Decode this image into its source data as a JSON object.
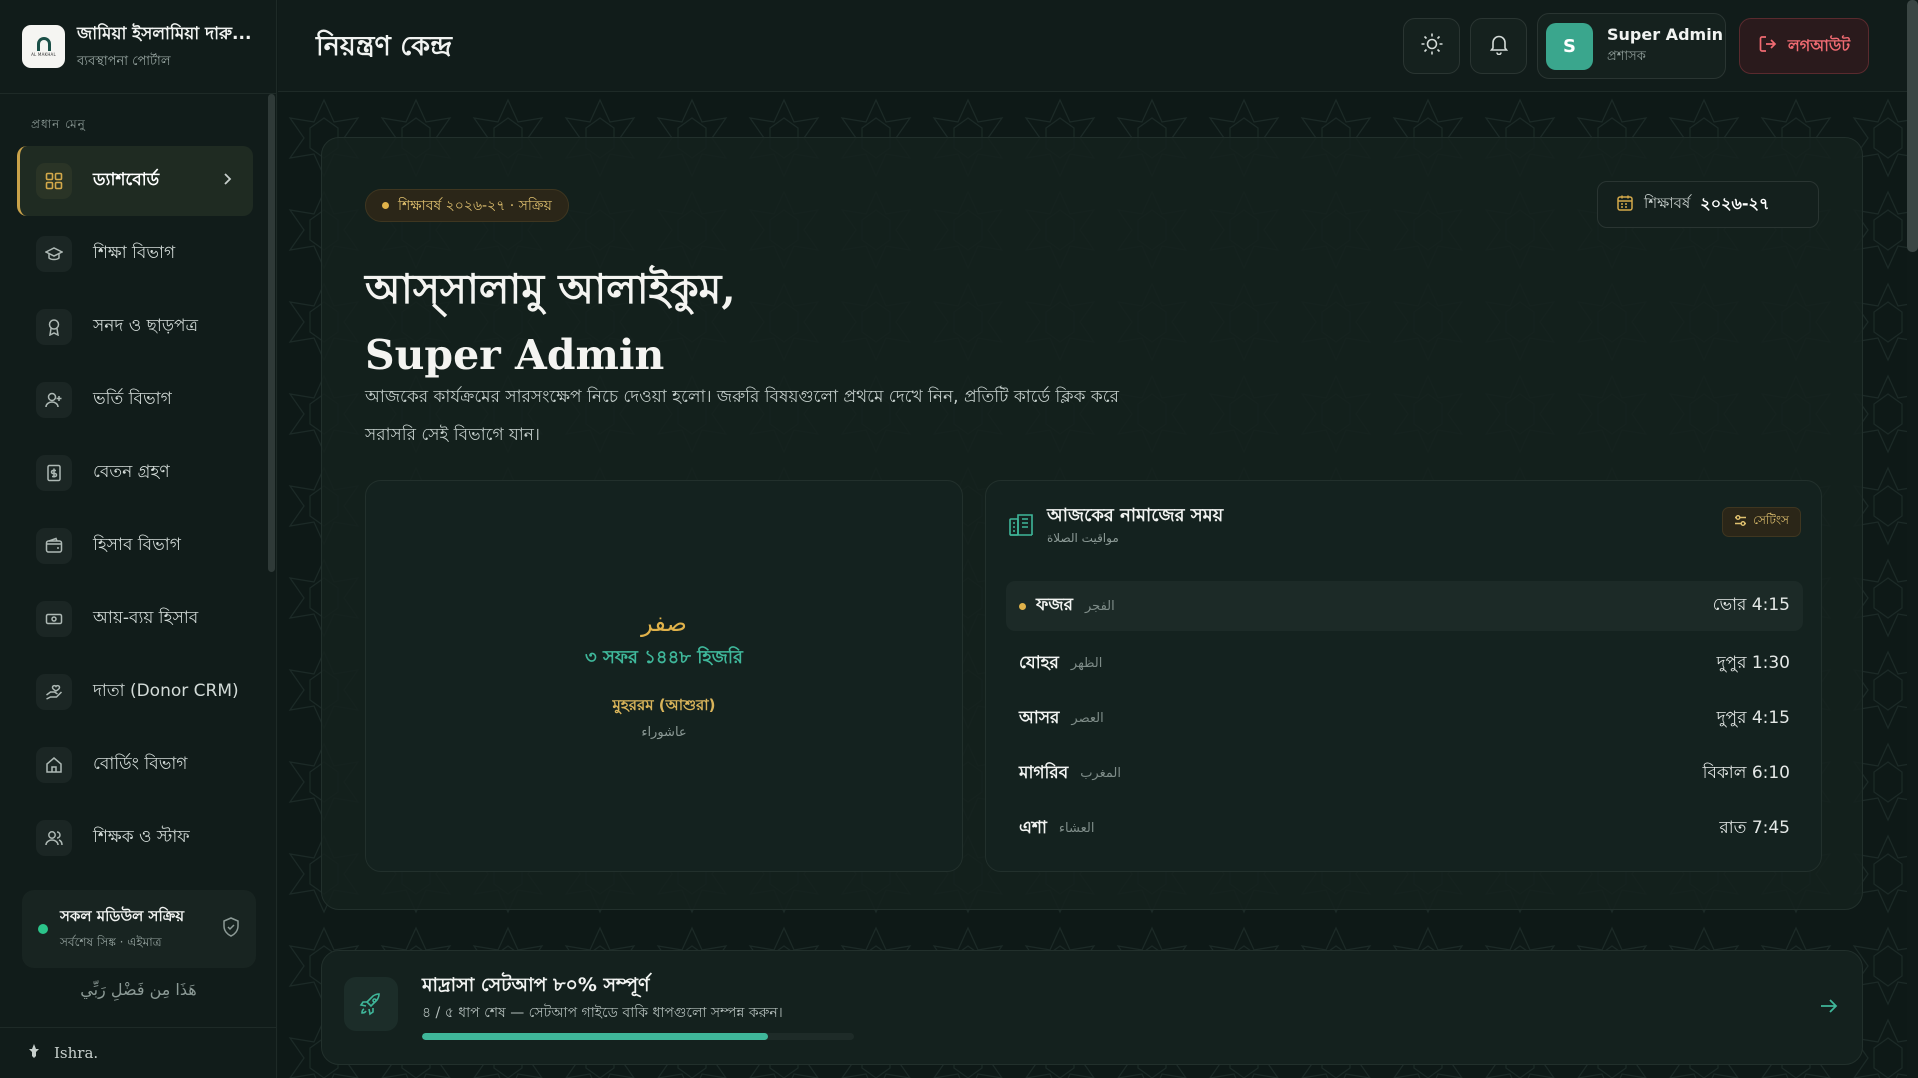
{
  "brand": {
    "title": "জামিয়া ইসলামিয়া দারু...",
    "subtitle": "ব্যবস্থাপনা পোর্টাল",
    "logo_text": "AL MAKHAL"
  },
  "sidebar": {
    "section_label": "প্রধান মেনু",
    "items": [
      {
        "label": "ড্যাশবোর্ড",
        "icon": "grid-icon",
        "active": true
      },
      {
        "label": "শিক্ষা বিভাগ",
        "icon": "graduation-cap-icon"
      },
      {
        "label": "সনদ ও ছাড়পত্র",
        "icon": "award-icon"
      },
      {
        "label": "ভর্তি বিভাগ",
        "icon": "user-plus-icon"
      },
      {
        "label": "বেতন গ্রহণ",
        "icon": "receipt-icon"
      },
      {
        "label": "হিসাব বিভাগ",
        "icon": "wallet-icon"
      },
      {
        "label": "আয়-ব্যয় হিসাব",
        "icon": "cash-icon"
      },
      {
        "label": "দাতা (Donor CRM)",
        "icon": "hand-heart-icon"
      },
      {
        "label": "বোর্ডিং বিভাগ",
        "icon": "home-icon"
      },
      {
        "label": "শিক্ষক ও স্টাফ",
        "icon": "users-icon"
      }
    ],
    "status": {
      "title": "সকল মডিউল সক্রিয়",
      "subtitle": "সর্বশেষ সিঙ্ক · এইমাত্র"
    },
    "arabic_footer": "هَذَا مِن فَضْلِ رَبِّي",
    "footer_user": "Ishra."
  },
  "topbar": {
    "title": "নিয়ন্ত্রণ কেন্দ্র",
    "user_name": "Super Admin",
    "user_role": "প্রশাসক",
    "avatar_letter": "S",
    "logout_label": "লগআউট"
  },
  "hero": {
    "session_pill": "শিক্ষাবর্ষ ২০২৬-২৭ · সক্রিয়",
    "year_label": "শিক্ষাবর্ষ",
    "year_value": "২০২৬-২৭",
    "greeting_line1": "আস্‌সালামু আলাইকুম,",
    "greeting_line2": "Super Admin",
    "intro": "আজকের কার্যক্রমের সারসংক্ষেপ নিচে দেওয়া হলো। জরুরি বিষয়গুলো প্রথমে দেখে নিন, প্রতিটি কার্ডে ক্লিক করে সরাসরি সেই বিভাগে যান।"
  },
  "hijri": {
    "month_ar": "صفر",
    "date": "৩ সফর ১৪৪৮ হিজরি",
    "event": "মুহররম (আশুরা)",
    "event_ar": "عاشوراء"
  },
  "prayer": {
    "title": "আজকের নামাজের সময়",
    "subtitle_ar": "مواقيت الصلاة",
    "settings_label": "সেটিংস",
    "rows": [
      {
        "name": "ফজর",
        "ar": "الفجر",
        "time": "ভোর 4:15",
        "current": true
      },
      {
        "name": "যোহর",
        "ar": "الظهر",
        "time": "দুপুর 1:30"
      },
      {
        "name": "আসর",
        "ar": "العصر",
        "time": "দুপুর 4:15"
      },
      {
        "name": "মাগরিব",
        "ar": "المغرب",
        "time": "বিকাল 6:10"
      },
      {
        "name": "এশা",
        "ar": "العشاء",
        "time": "রাত 7:45"
      }
    ]
  },
  "setup": {
    "title": "মাদ্রাসা সেটআপ ৮০% সম্পূর্ণ",
    "subtitle": "৪ / ৫ ধাপ শেষ — সেটআপ গাইডে বাকি ধাপগুলো সম্পন্ন করুন।",
    "progress": 0.8
  },
  "colors": {
    "accent_gold": "#e0b24a",
    "accent_teal": "#3fb79a",
    "danger": "#f06b72"
  }
}
